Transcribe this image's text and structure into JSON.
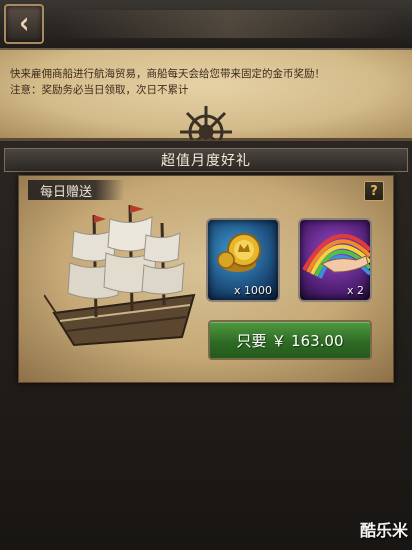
{
  "header": {
    "back_icon": "back-chevron-icon"
  },
  "notice": {
    "line1": "快来雇佣商船进行航海贸易，商船每天会给您带来固定的金币奖励！",
    "line2": "注意：奖励务必当日领取，次日不累计"
  },
  "offer": {
    "section_title": "超值月度好礼",
    "tab_label": "每日赠送",
    "help_label": "?",
    "items": [
      {
        "icon": "gold-coin-icon",
        "quantity": "x 1000"
      },
      {
        "icon": "rainbow-hand-icon",
        "quantity": "x 2"
      }
    ],
    "buy_label": "只要 ￥ 163.00"
  },
  "watermark": {
    "text": "酷乐米"
  },
  "colors": {
    "parchment": "#d3ba89",
    "buy_button": "#3f8a32",
    "panel": "#221e1a"
  }
}
